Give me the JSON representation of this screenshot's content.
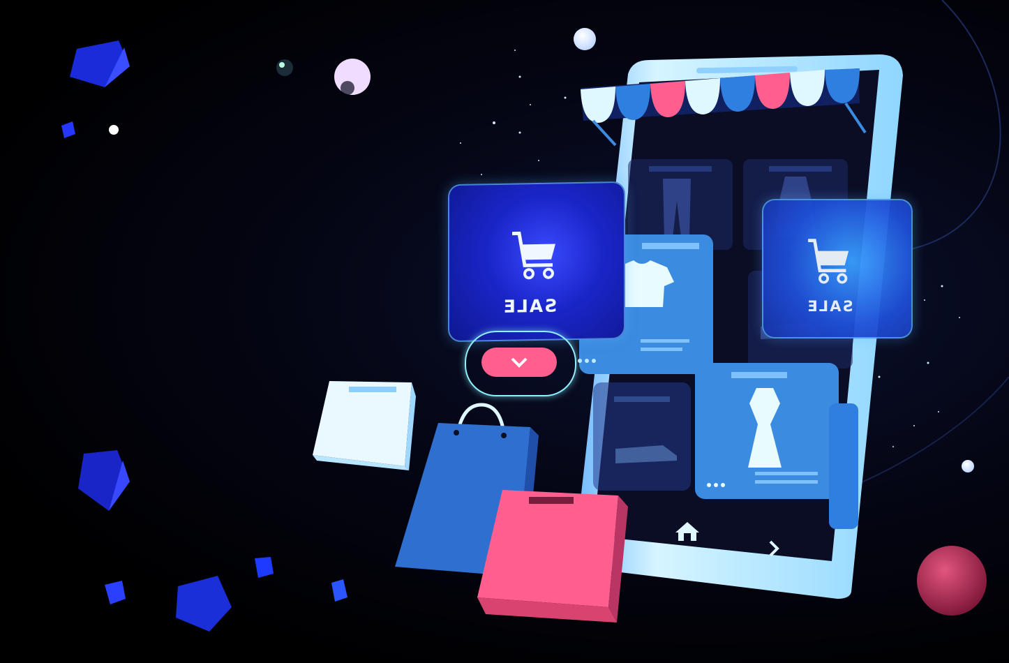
{
  "scene": {
    "sale_cards": [
      {
        "label": "SALE",
        "icon": "shopping-cart-icon"
      },
      {
        "label": "SALE",
        "icon": "shopping-cart-icon"
      }
    ],
    "phone": {
      "nav_icons": [
        "home-icon",
        "chevron-right-icon"
      ],
      "products": [
        "pants-icon",
        "dress-icon",
        "tshirt-icon",
        "sneaker-icon",
        "shoe-icon",
        "dress-icon"
      ]
    },
    "dropdown_button_icon": "chevron-down-icon",
    "colors": {
      "background": "#020205",
      "phone_frame": "#bfefff",
      "accent_pink": "#ff5f8f",
      "accent_blue": "#2f7fe0",
      "sale_card": "#1a25c8",
      "product_card": "#3b8be0"
    }
  }
}
